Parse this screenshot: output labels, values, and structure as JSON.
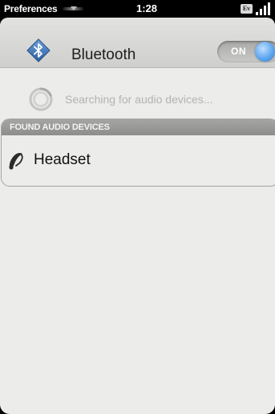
{
  "status_bar": {
    "app_menu_label": "Preferences",
    "time": "1:28",
    "network_badge": "Ev",
    "signal_bars": 4
  },
  "header": {
    "icon": "bluetooth-icon",
    "title": "Bluetooth",
    "toggle_label": "ON",
    "toggle_state": "on"
  },
  "search": {
    "icon": "spinner-icon",
    "status_text": "Searching for audio devices..."
  },
  "found_devices": {
    "header_label": "FOUND AUDIO DEVICES",
    "items": [
      {
        "icon": "headset-icon",
        "label": "Headset"
      }
    ]
  },
  "colors": {
    "toggle_knob": "#5fa6ef",
    "bluetooth_icon": "#3e73b6",
    "background": "#ececea"
  }
}
